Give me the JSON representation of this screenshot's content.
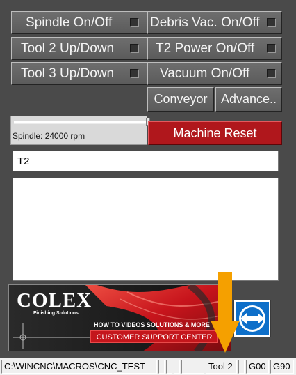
{
  "buttons": {
    "spindle": "Spindle On/Off",
    "debris_vac": "Debris Vac. On/Off",
    "tool2": "Tool 2 Up/Down",
    "t2_power": "T2 Power On/Off",
    "tool3": "Tool 3 Up/Down",
    "vacuum": "Vacuum On/Off",
    "conveyor": "Conveyor",
    "advance": "Advance..",
    "machine_reset": "Machine Reset"
  },
  "spindle_slider": {
    "label": "Spindle: 24000 rpm",
    "level": 1.0
  },
  "tool_field": {
    "value": "T2"
  },
  "banner": {
    "brand": "COLEX",
    "tagline": "Finishing Solutions",
    "promo": "HOW TO VIDEOS SOLUTIONS & MORE",
    "support": "CUSTOMER SUPPORT CENTER"
  },
  "status": {
    "path": "C:\\WINCNC\\MACROS\\CNC_TEST",
    "tool": "Tool 2",
    "gcode1": "G00",
    "gcode2": "G90"
  },
  "colors": {
    "panel_bg": "#4a4a4a",
    "button_bg": "#626262",
    "reset_red": "#b0171c",
    "arrow_orange": "#f5a000",
    "teamviewer_blue": "#0e6fc9"
  }
}
